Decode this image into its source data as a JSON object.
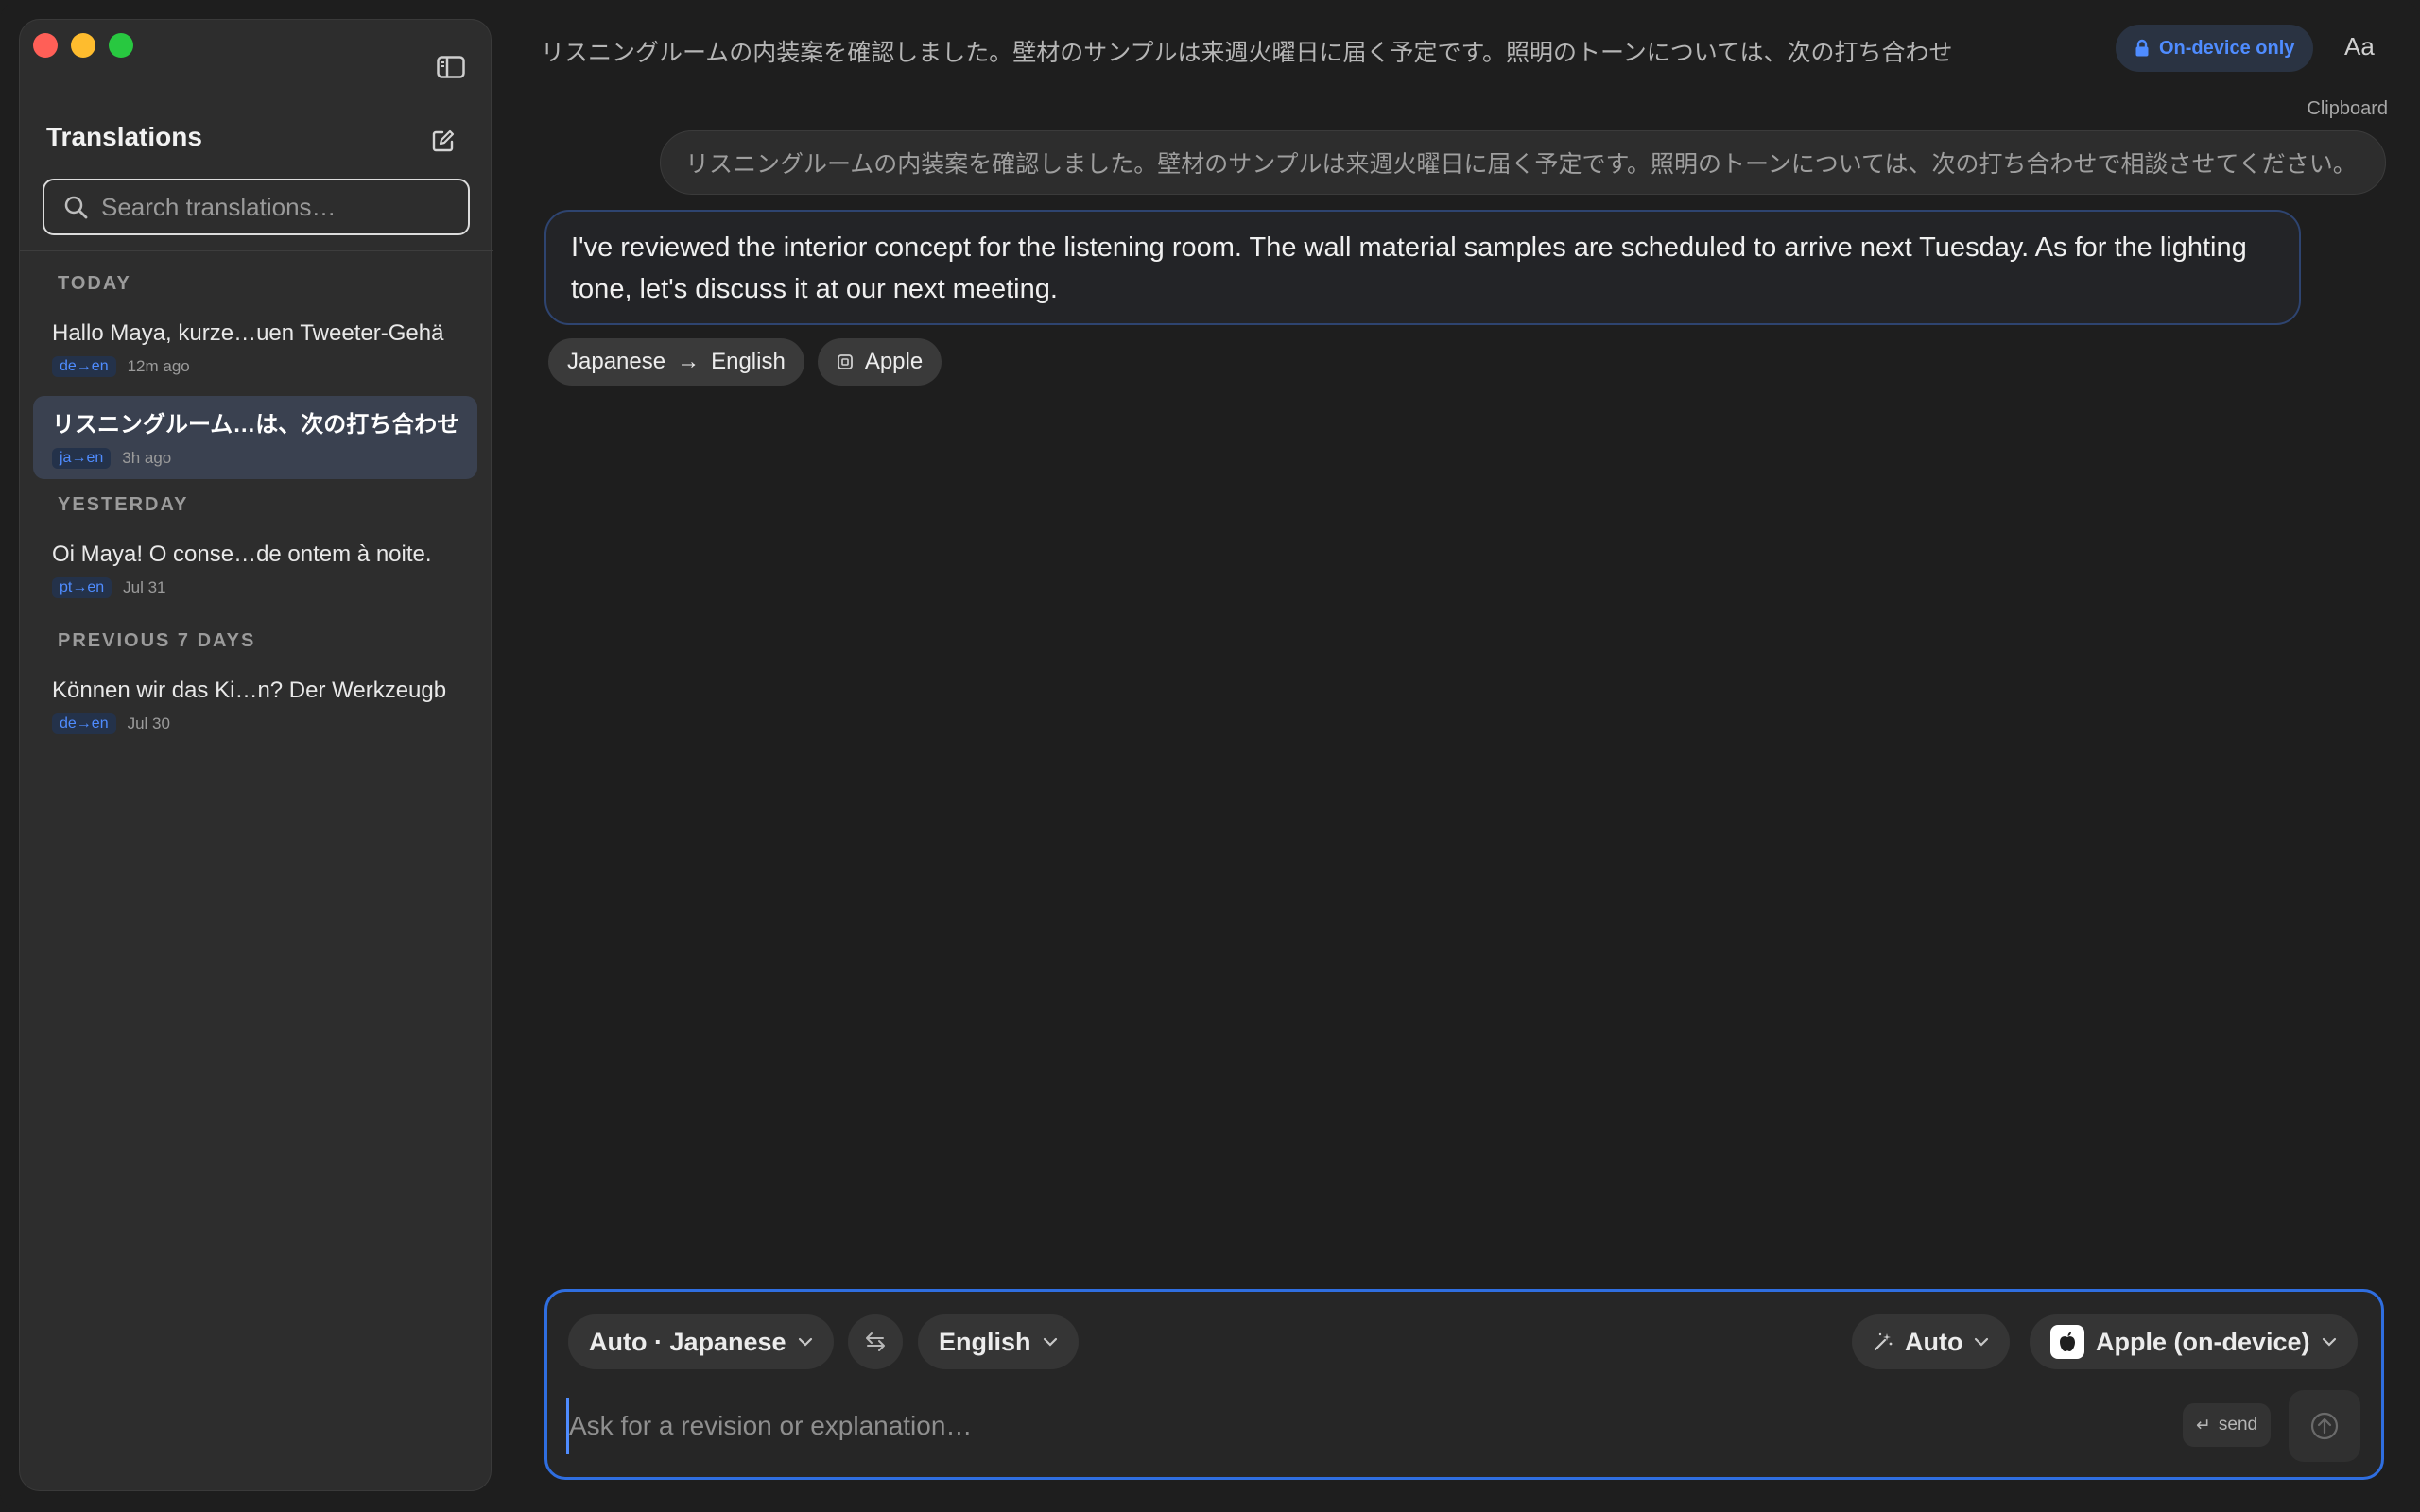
{
  "sidebar": {
    "title": "Translations",
    "search_placeholder": "Search translations…",
    "sections": [
      {
        "label": "TODAY"
      },
      {
        "label": "YESTERDAY"
      },
      {
        "label": "PREVIOUS 7 DAYS"
      }
    ],
    "items": [
      {
        "title": "Hallo Maya, kurze…uen Tweeter-Gehä",
        "badge": "de→en",
        "ago": "12m ago"
      },
      {
        "title": "リスニングルーム…は、次の打ち合わせ",
        "badge": "ja→en",
        "ago": "3h ago"
      },
      {
        "title": "Oi Maya! O conse…de ontem à noite.",
        "badge": "pt→en",
        "ago": "Jul 31"
      },
      {
        "title": "Können wir das Ki…n? Der Werkzeugb",
        "badge": "de→en",
        "ago": "Jul 30"
      }
    ]
  },
  "header": {
    "title": "リスニングルームの内装案を確認しました。壁材のサンプルは来週火曜日に届く予定です。照明のトーンについては、次の打ち合わせ",
    "privacy_badge": "On-device only",
    "font_button": "Aa"
  },
  "conversation": {
    "source_label": "Clipboard",
    "source_text": "リスニングルームの内装案を確認しました。壁材のサンプルは来週火曜日に届く予定です。照明のトーンについては、次の打ち合わせで相談させてください。",
    "translation": "I've reviewed the interior concept for the listening room. The wall material samples are scheduled to arrive next Tuesday. As for the lighting tone, let's discuss it at our next meeting.",
    "chip_from": "Japanese",
    "chip_arrow": "→",
    "chip_to": "English",
    "chip_engine": "Apple"
  },
  "composer": {
    "source_lang": "Auto · Japanese",
    "target_lang": "English",
    "mode": "Auto",
    "engine": "Apple (on-device)",
    "placeholder": "Ask for a revision or explanation…",
    "send_hint": "send",
    "send_hint_glyph": "↵"
  },
  "colors": {
    "accent": "#4f8cff",
    "active_row": "#3a4150",
    "composer_border": "#2f6ee0"
  }
}
